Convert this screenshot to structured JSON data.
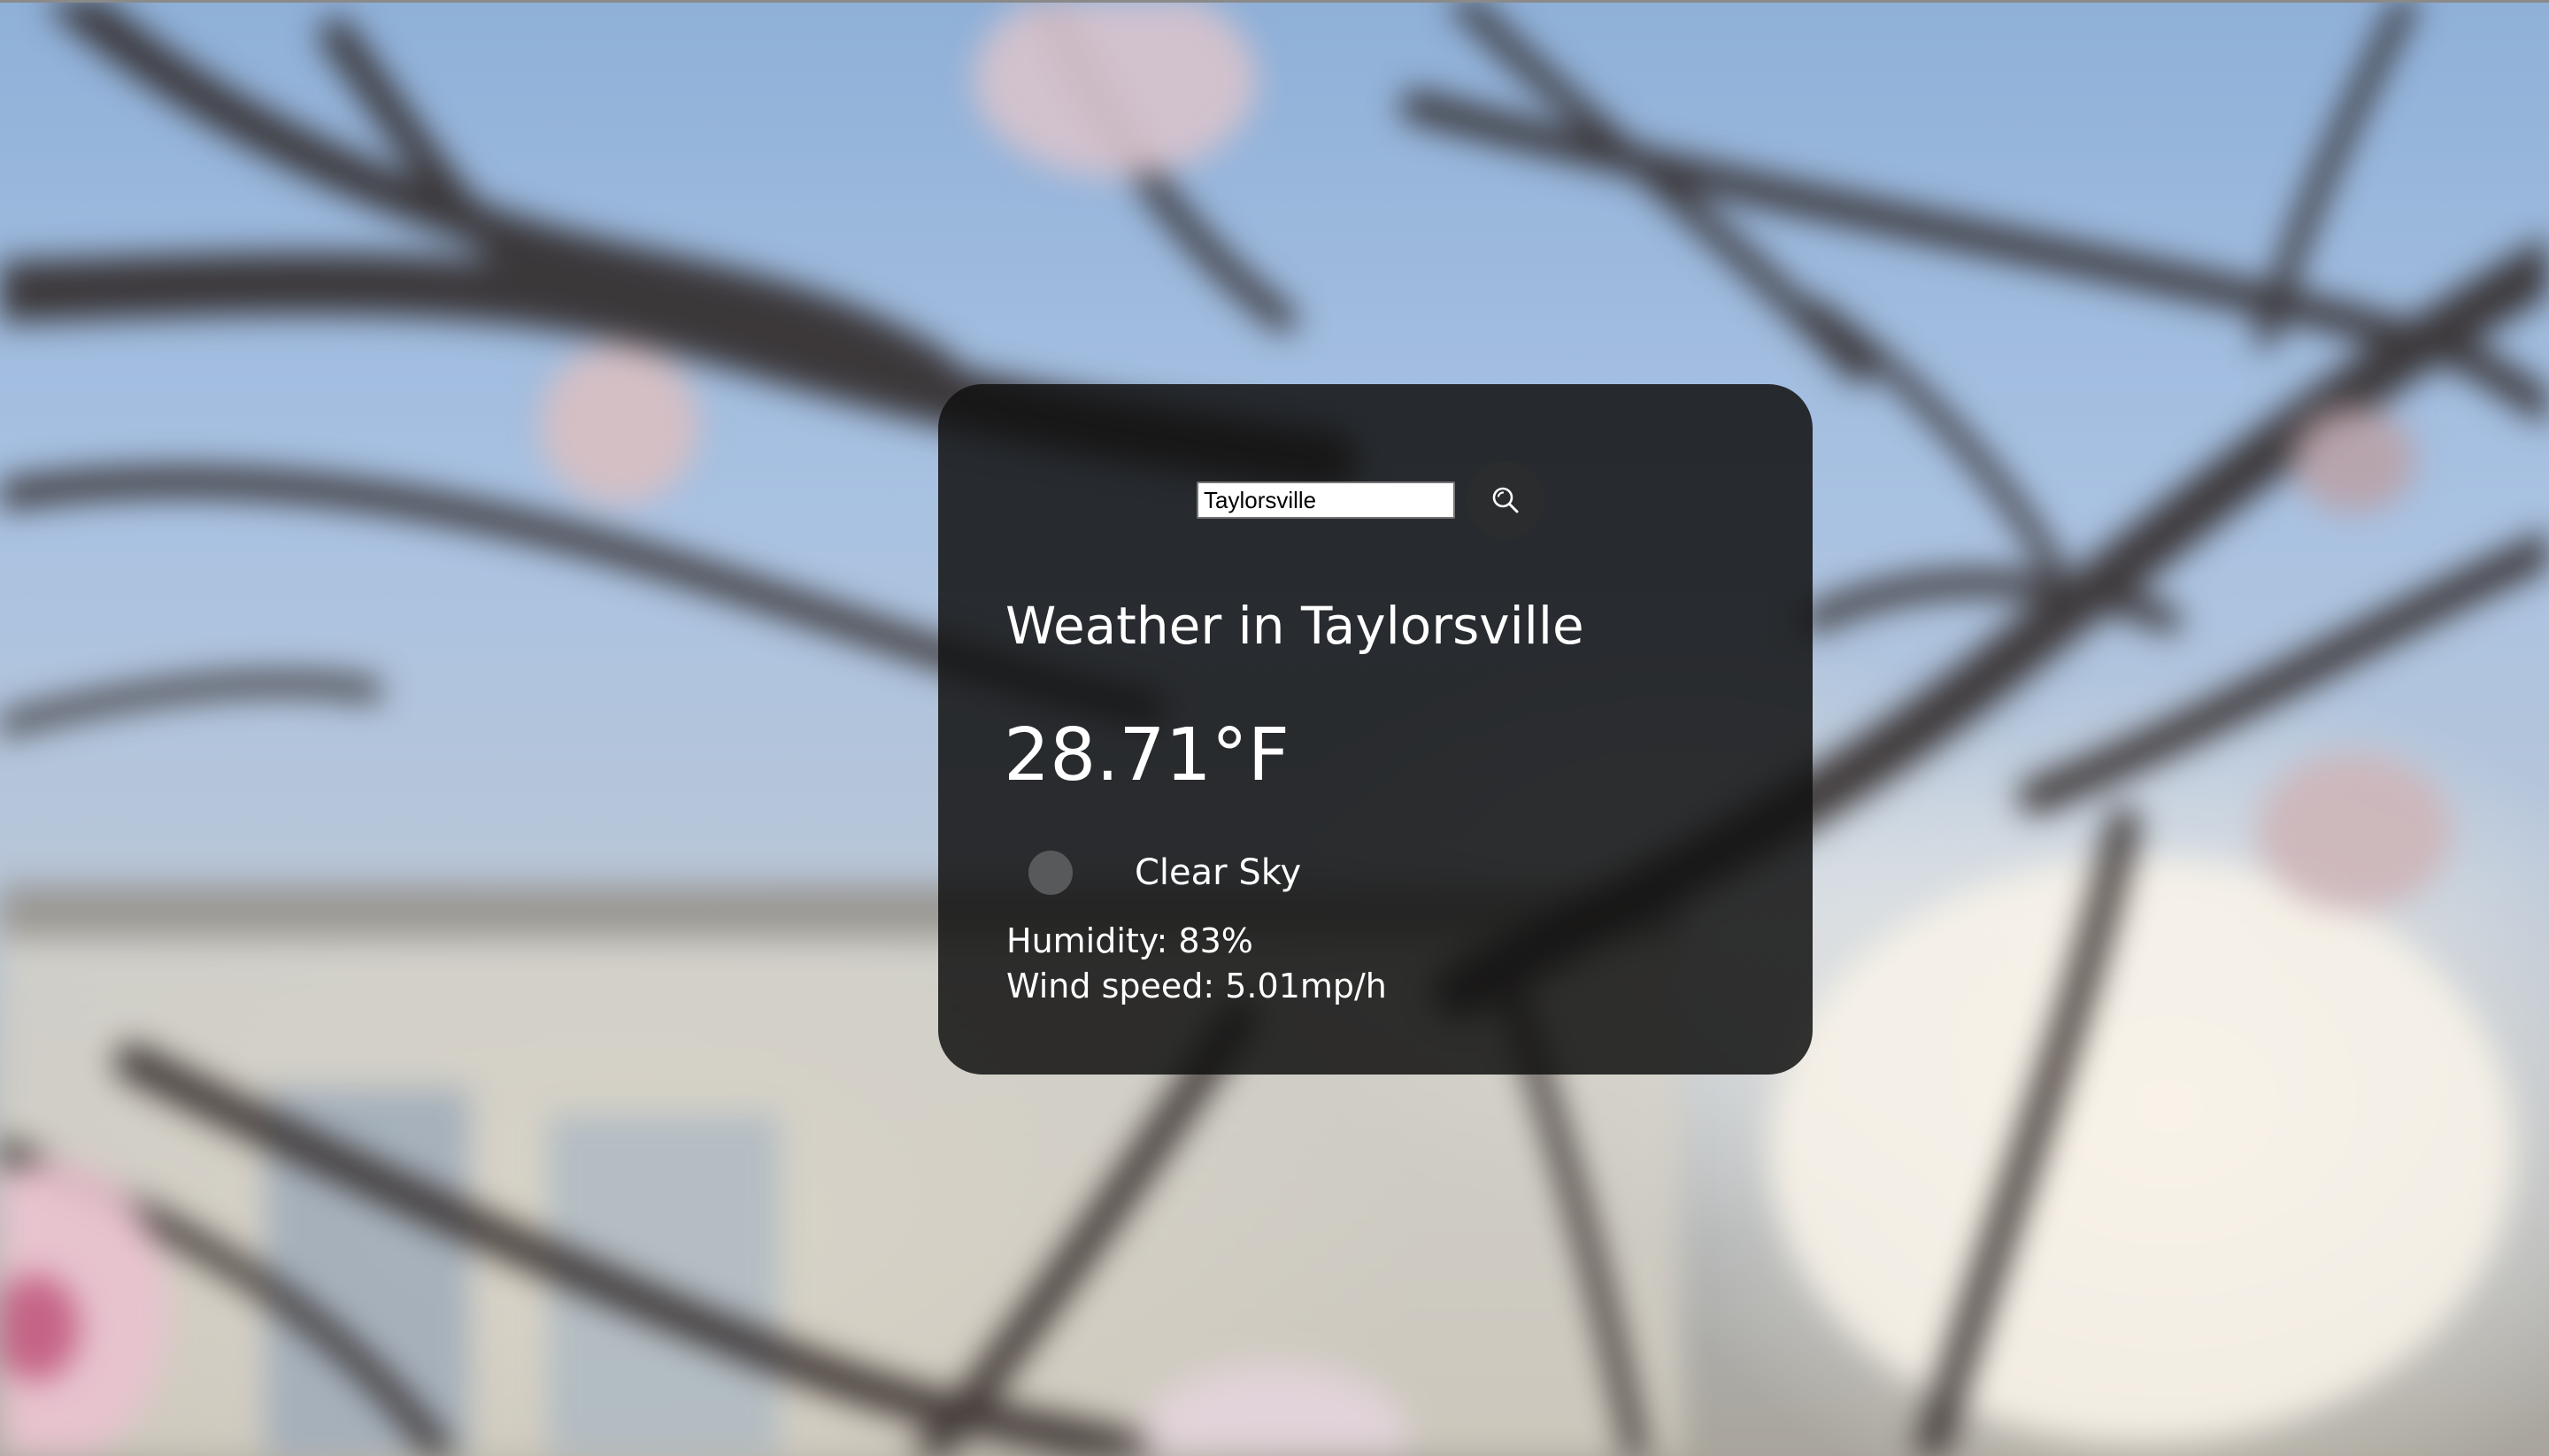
{
  "search": {
    "value": "Taylorsville",
    "placeholder": "",
    "button_icon": "search-icon"
  },
  "weather": {
    "title": "Weather in Taylorsville",
    "temperature": "28.71°F",
    "description": "Clear Sky",
    "description_icon": "weather-condition-icon",
    "humidity": "Humidity: 83%",
    "wind_speed": "Wind speed: 5.01mp/h"
  },
  "colors": {
    "card_background": "#111112",
    "search_button": "#2b2c2e",
    "text": "#ffffff"
  }
}
